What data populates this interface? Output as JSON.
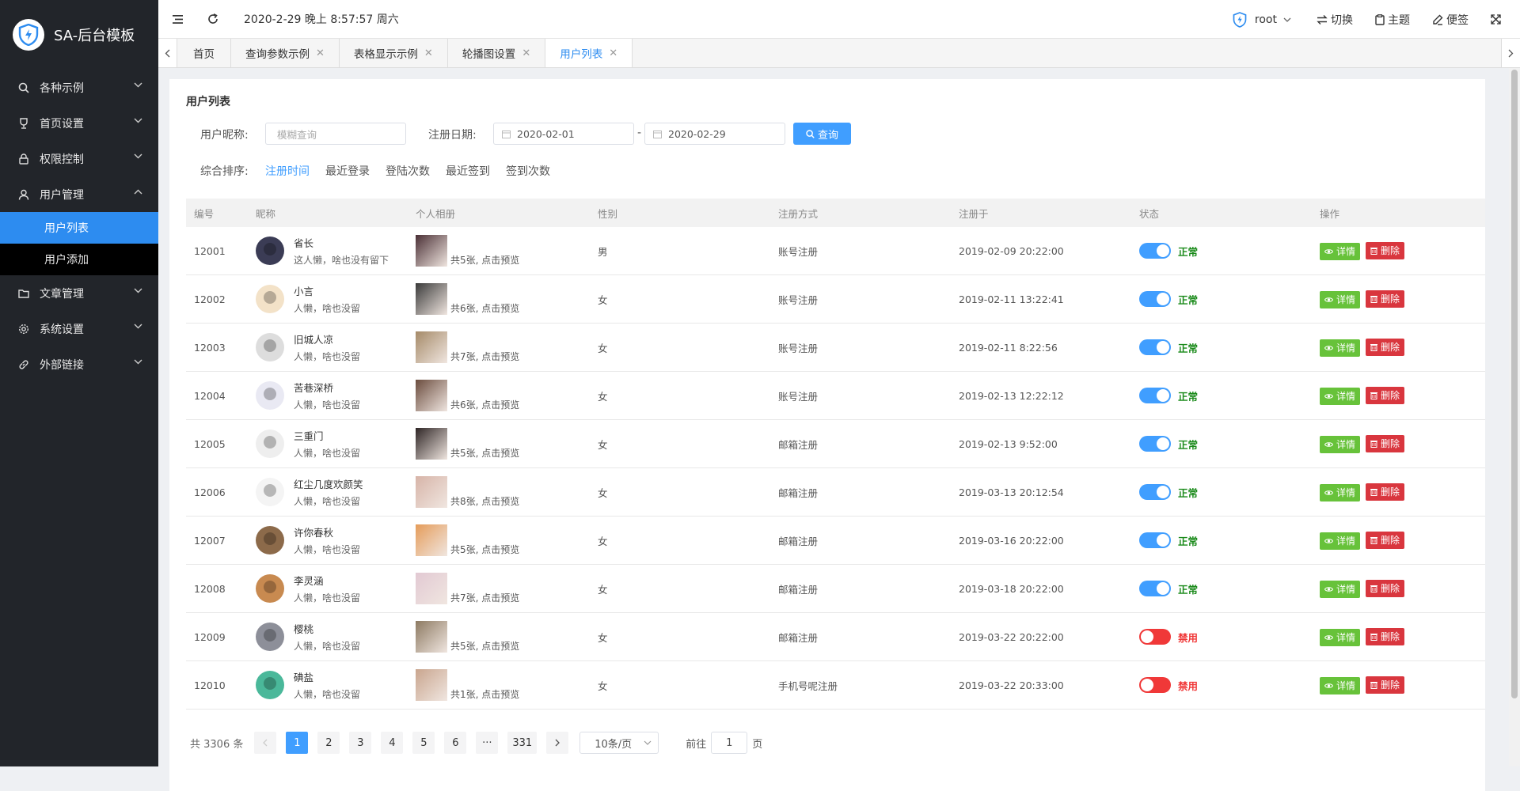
{
  "app": {
    "title": "SA-后台模板"
  },
  "sidebar": {
    "items": [
      {
        "label": "各种示例",
        "icon": "search-icon",
        "expanded": false
      },
      {
        "label": "首页设置",
        "icon": "trophy-icon",
        "expanded": false
      },
      {
        "label": "权限控制",
        "icon": "lock-icon",
        "expanded": false
      },
      {
        "label": "用户管理",
        "icon": "user-icon",
        "expanded": true
      },
      {
        "label": "文章管理",
        "icon": "folder-icon",
        "expanded": false
      },
      {
        "label": "系统设置",
        "icon": "gear-icon",
        "expanded": false
      },
      {
        "label": "外部链接",
        "icon": "link-icon",
        "expanded": false
      }
    ],
    "user_sub": [
      {
        "label": "用户列表",
        "active": true
      },
      {
        "label": "用户添加",
        "active": false
      }
    ]
  },
  "topbar": {
    "datetime": "2020-2-29 晚上 8:57:57 周六",
    "user": "root",
    "switch_label": "切换",
    "theme_label": "主题",
    "note_label": "便签"
  },
  "tabs": [
    {
      "label": "首页",
      "closable": false,
      "active": false
    },
    {
      "label": "查询参数示例",
      "closable": true,
      "active": false
    },
    {
      "label": "表格显示示例",
      "closable": true,
      "active": false
    },
    {
      "label": "轮播图设置",
      "closable": true,
      "active": false
    },
    {
      "label": "用户列表",
      "closable": true,
      "active": true
    }
  ],
  "page": {
    "title": "用户列表",
    "filter": {
      "nickname_label": "用户昵称:",
      "nickname_placeholder": "模糊查询",
      "date_label": "注册日期:",
      "date_start": "2020-02-01",
      "date_sep": "-",
      "date_end": "2020-02-29",
      "query_label": "查询"
    },
    "sort": {
      "label": "综合排序:",
      "options": [
        "注册时间",
        "最近登录",
        "登陆次数",
        "最近签到",
        "签到次数"
      ],
      "active_index": 0
    }
  },
  "table": {
    "columns": [
      "编号",
      "昵称",
      "个人相册",
      "性别",
      "注册方式",
      "注册于",
      "状态",
      "操作"
    ],
    "detail_label": "详情",
    "delete_label": "删除",
    "rows": [
      {
        "id": "12001",
        "name": "省长",
        "desc": "这人懒，啥也没有留下",
        "album": "共5张, 点击预览",
        "gender": "男",
        "reg_method": "账号注册",
        "reg_time": "2019-02-09 20:22:00",
        "enabled": true,
        "status": "正常"
      },
      {
        "id": "12002",
        "name": "小言",
        "desc": "人懒，啥也没留",
        "album": "共6张, 点击预览",
        "gender": "女",
        "reg_method": "账号注册",
        "reg_time": "2019-02-11 13:22:41",
        "enabled": true,
        "status": "正常"
      },
      {
        "id": "12003",
        "name": "旧城人凉",
        "desc": "人懒，啥也没留",
        "album": "共7张, 点击预览",
        "gender": "女",
        "reg_method": "账号注册",
        "reg_time": "2019-02-11 8:22:56",
        "enabled": true,
        "status": "正常"
      },
      {
        "id": "12004",
        "name": "苦巷深桥",
        "desc": "人懒，啥也没留",
        "album": "共6张, 点击预览",
        "gender": "女",
        "reg_method": "账号注册",
        "reg_time": "2019-02-13 12:22:12",
        "enabled": true,
        "status": "正常"
      },
      {
        "id": "12005",
        "name": "三重门",
        "desc": "人懒，啥也没留",
        "album": "共5张, 点击预览",
        "gender": "女",
        "reg_method": "邮箱注册",
        "reg_time": "2019-02-13 9:52:00",
        "enabled": true,
        "status": "正常"
      },
      {
        "id": "12006",
        "name": "红尘几度欢颜笑",
        "desc": "人懒，啥也没留",
        "album": "共8张, 点击预览",
        "gender": "女",
        "reg_method": "邮箱注册",
        "reg_time": "2019-03-13 20:12:54",
        "enabled": true,
        "status": "正常"
      },
      {
        "id": "12007",
        "name": "许你春秋",
        "desc": "人懒，啥也没留",
        "album": "共5张, 点击预览",
        "gender": "女",
        "reg_method": "邮箱注册",
        "reg_time": "2019-03-16 20:22:00",
        "enabled": true,
        "status": "正常"
      },
      {
        "id": "12008",
        "name": "李灵涵",
        "desc": "人懒，啥也没留",
        "album": "共7张, 点击预览",
        "gender": "女",
        "reg_method": "邮箱注册",
        "reg_time": "2019-03-18 20:22:00",
        "enabled": true,
        "status": "正常"
      },
      {
        "id": "12009",
        "name": "樱桃",
        "desc": "人懒，啥也没留",
        "album": "共5张, 点击预览",
        "gender": "女",
        "reg_method": "邮箱注册",
        "reg_time": "2019-03-22 20:22:00",
        "enabled": false,
        "status": "禁用"
      },
      {
        "id": "12010",
        "name": "碘盐",
        "desc": "人懒，啥也没留",
        "album": "共1张, 点击预览",
        "gender": "女",
        "reg_method": "手机号呢注册",
        "reg_time": "2019-03-22 20:33:00",
        "enabled": false,
        "status": "禁用"
      }
    ]
  },
  "pagination": {
    "total_text": "共 3306 条",
    "pages": [
      "1",
      "2",
      "3",
      "4",
      "5",
      "6",
      "···",
      "331"
    ],
    "current": "1",
    "page_size": "10条/页",
    "goto_prefix": "前往",
    "goto_value": "1",
    "goto_suffix": "页"
  },
  "colors": {
    "sidebar_bg": "#22252a",
    "accent": "#409eff",
    "active_nav": "#2d8cf0",
    "success": "#67c23a",
    "danger": "#d9363e",
    "status_ok": "#1a8a1a",
    "status_off": "#f03838"
  }
}
